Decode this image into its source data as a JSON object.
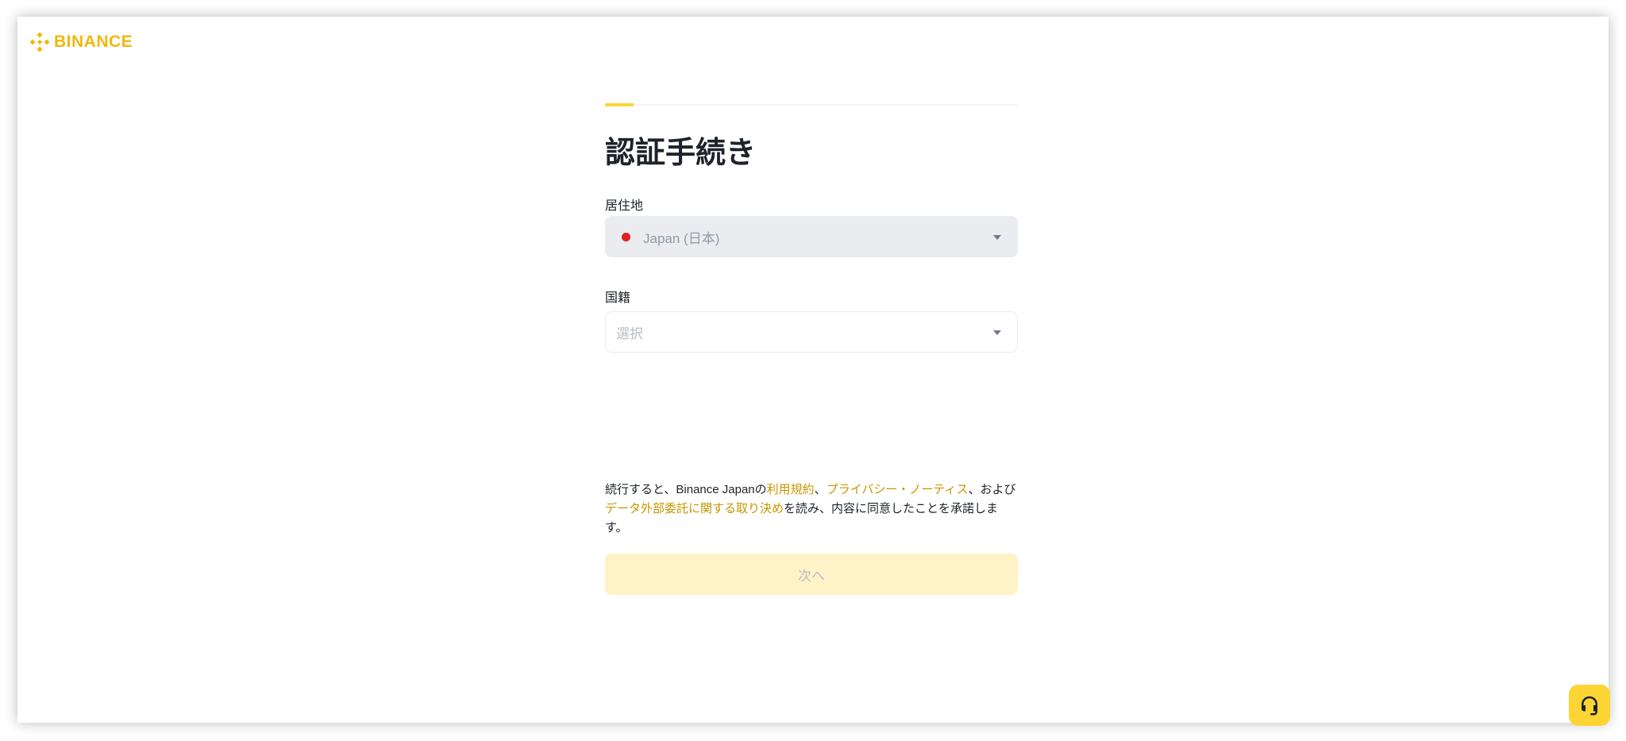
{
  "brand": {
    "name": "BINANCE",
    "color": "#f0b90b",
    "icon": "binance-logo-icon"
  },
  "page": {
    "title": "認証手続き"
  },
  "progress": {
    "fraction": 0.07,
    "accent": "#fcd535"
  },
  "residence": {
    "label": "居住地",
    "value": "Japan (日本)",
    "flag_icon": "japan-flag-icon",
    "disabled": true
  },
  "nationality": {
    "label": "国籍",
    "placeholder": "選択"
  },
  "terms": {
    "text_1": "続行すると、Binance Japanの",
    "link_terms": "利用規約",
    "sep_1": "、",
    "link_privacy": "プライバシー・ノーティス",
    "text_2": "、および",
    "link_outsourcing": "データ外部委託に関する取り決め",
    "text_3": "を読み、内容に同意したことを承諾します。",
    "link_color": "#c99400"
  },
  "next_button": {
    "label": "次へ",
    "disabled": true
  },
  "support": {
    "icon": "headset-icon"
  }
}
